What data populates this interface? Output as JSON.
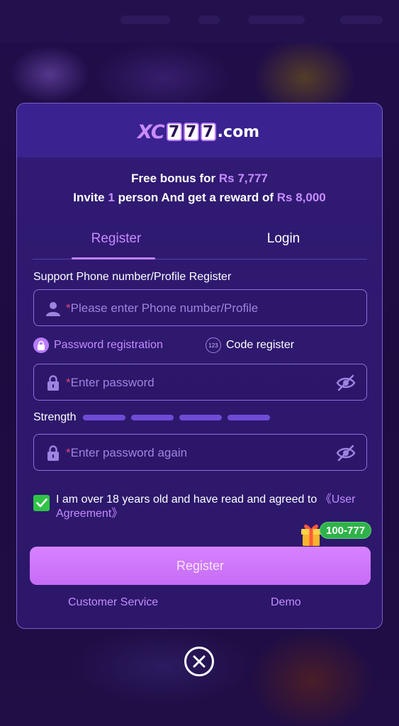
{
  "logo": {
    "prefix": "XC",
    "digits": [
      "7",
      "7",
      "7"
    ],
    "suffix": ".com"
  },
  "promo": {
    "line1_text": "Free bonus for",
    "line1_amount": "Rs 7,777",
    "line2_text_a": "Invite",
    "line2_count": "1",
    "line2_text_b": "person And get a reward of",
    "line2_amount": "Rs 8,000"
  },
  "tabs": {
    "register": "Register",
    "login": "Login"
  },
  "form": {
    "support_label": "Support Phone number/Profile Register",
    "phone_placeholder": "Please enter Phone number/Profile",
    "required_mark": "*",
    "option_password": "Password registration",
    "option_code": "Code register",
    "code_icon_text": "123",
    "password_placeholder": "Enter password",
    "strength_label": "Strength",
    "password_again_placeholder": "Enter password again",
    "agreement_text": "I am over 18 years old and have read and agreed to",
    "agreement_link": "《User Agreement》",
    "agreement_checked": true
  },
  "promo_badge": "100-777",
  "register_button": "Register",
  "footer": {
    "customer_service": "Customer Service",
    "demo": "Demo"
  },
  "colors": {
    "accent": "#c58bff",
    "button": "#d07af9",
    "check": "#2fc447"
  }
}
